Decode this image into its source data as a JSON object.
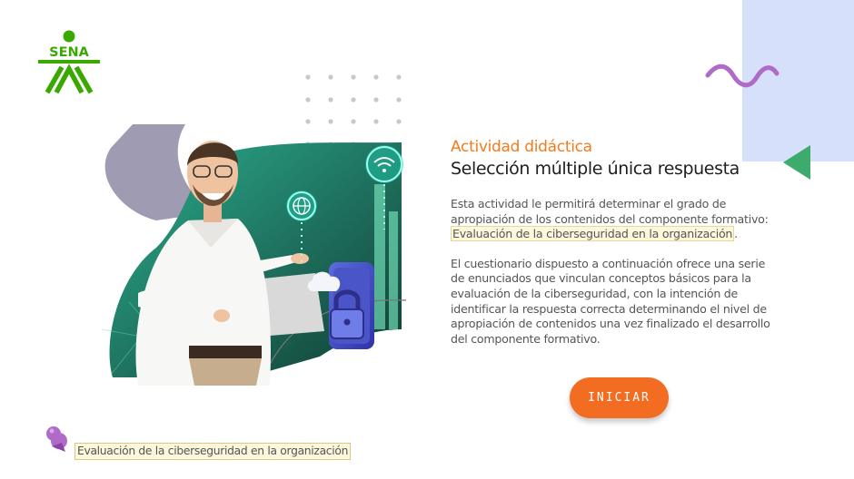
{
  "brand": {
    "logo_text": "SENA",
    "color": "#39a900"
  },
  "activity": {
    "kicker": "Actividad didáctica",
    "title": "Selección múltiple única respuesta",
    "intro": "Esta actividad le permitirá determinar el grado de apropiación de los contenidos del componente formativo:",
    "component_name": "Evaluación de la ciberseguridad en la organización",
    "period": ".",
    "description": "El cuestionario dispuesto a continuación ofrece una serie de enunciados que vinculan conceptos básicos para la evaluación de la ciberseguridad, con la intención de identificar la respuesta correcta determinando el nivel de apropiación de contenidos una vez finalizado el desarrollo del componente formativo.",
    "start_label": "INICIAR"
  },
  "footer": {
    "component_name": "Evaluación de la ciberseguridad en la organización"
  },
  "colors": {
    "accent_orange": "#f26d21",
    "kicker_orange": "#f07c1f",
    "deco_blue": "#d6e0fb",
    "deco_purple": "#b06ac8",
    "deco_green": "#3dab6b"
  },
  "icons": [
    "sena-logo",
    "wave-decoration",
    "triangle-decoration",
    "pin-icon",
    "wifi-icon",
    "globe-icon",
    "cloud-icon",
    "lock-icon"
  ]
}
